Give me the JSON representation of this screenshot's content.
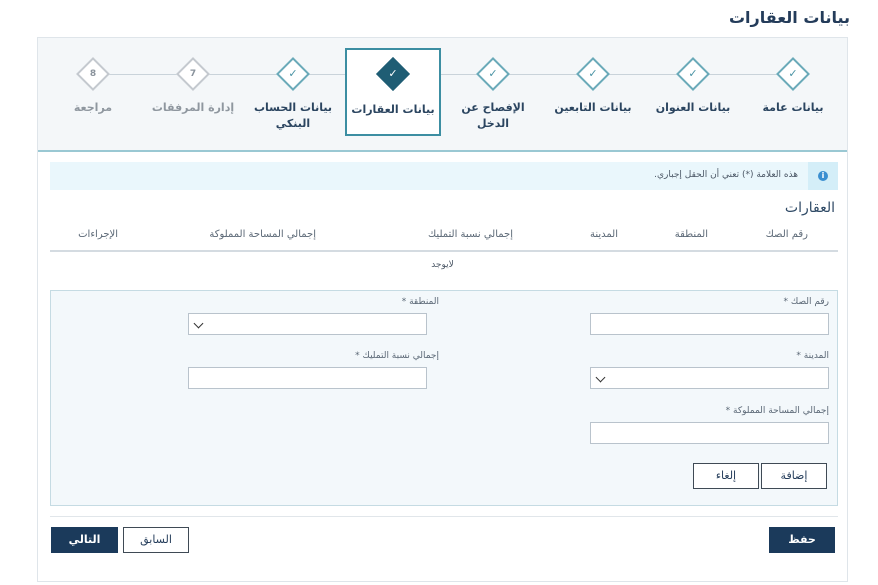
{
  "page": {
    "title": "بيانات العقارات"
  },
  "stepper": {
    "steps": [
      {
        "label": "بيانات عامة",
        "marker": "✓"
      },
      {
        "label": "بيانات العنوان",
        "marker": "✓"
      },
      {
        "label": "بيانات التابعين",
        "marker": "✓"
      },
      {
        "label": "الإفصاح عن الدخل",
        "marker": "✓"
      },
      {
        "label": "بيانات العقارات",
        "marker": "✓"
      },
      {
        "label": "بيانات الحساب البنكي",
        "marker": "✓"
      },
      {
        "label": "إدارة المرفقات",
        "marker": "7"
      },
      {
        "label": "مراجعة",
        "marker": "8"
      }
    ],
    "active_index": 4
  },
  "notice": {
    "text": "هذه العلامة (*) تعني أن الحقل إجباري."
  },
  "table": {
    "title": "العقارات",
    "columns": [
      "رقم الصك",
      "المنطقة",
      "المدينة",
      "إجمالي نسبة التمليك",
      "إجمالي المساحة المملوكة",
      "الإجراءات"
    ],
    "empty_text": "لايوجد"
  },
  "form": {
    "deed_number_label": "رقم الصك *",
    "region_label": "المنطقة *",
    "city_label": "المدينة *",
    "ownership_ratio_label": "إجمالي نسبة التمليك *",
    "owned_area_label": "إجمالي المساحة المملوكة *",
    "deed_number_value": "",
    "region_value": "",
    "city_value": "",
    "ownership_ratio_value": "",
    "owned_area_value": "",
    "add_label": "إضافة",
    "cancel_label": "إلغاء"
  },
  "footer": {
    "save_label": "حفظ",
    "previous_label": "السابق",
    "next_label": "التالي"
  }
}
